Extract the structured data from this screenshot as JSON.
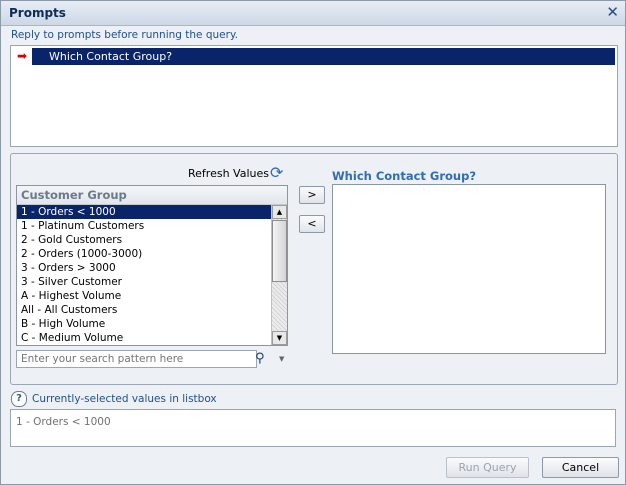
{
  "window": {
    "title": "Prompts",
    "close_icon": "close-icon"
  },
  "subtitle": "Reply to prompts before running the query.",
  "prompts": [
    {
      "label": "Which Contact Group?",
      "status_icon": "red-arrow-icon",
      "selected": true
    }
  ],
  "left_panel": {
    "refresh_label": "Refresh Values",
    "refresh_icon": "refresh-icon",
    "list_header": "Customer Group",
    "items": [
      "1 - Orders < 1000",
      "1 - Platinum Customers",
      "2 - Gold Customers",
      "2 - Orders (1000-3000)",
      "3 - Orders > 3000",
      "3 - Silver Customer",
      "A - Highest Volume",
      "All - All Customers",
      "B - High Volume",
      "C - Medium Volume"
    ],
    "selected_index": 0,
    "search": {
      "placeholder": "Enter your search pattern here",
      "value": ""
    },
    "search_icon": "binoculars-icon"
  },
  "move": {
    "add_label": ">",
    "remove_label": "<"
  },
  "right_panel": {
    "title": "Which Contact Group?",
    "values": []
  },
  "help": {
    "icon": "help-icon",
    "label": "Currently-selected values in listbox"
  },
  "current_selection": "1 - Orders < 1000",
  "buttons": {
    "run_label": "Run Query",
    "run_enabled": false,
    "cancel_label": "Cancel"
  },
  "colors": {
    "selection": "#0a246a",
    "accent_text": "#2f6db5",
    "status_arrow": "#dd0000"
  }
}
